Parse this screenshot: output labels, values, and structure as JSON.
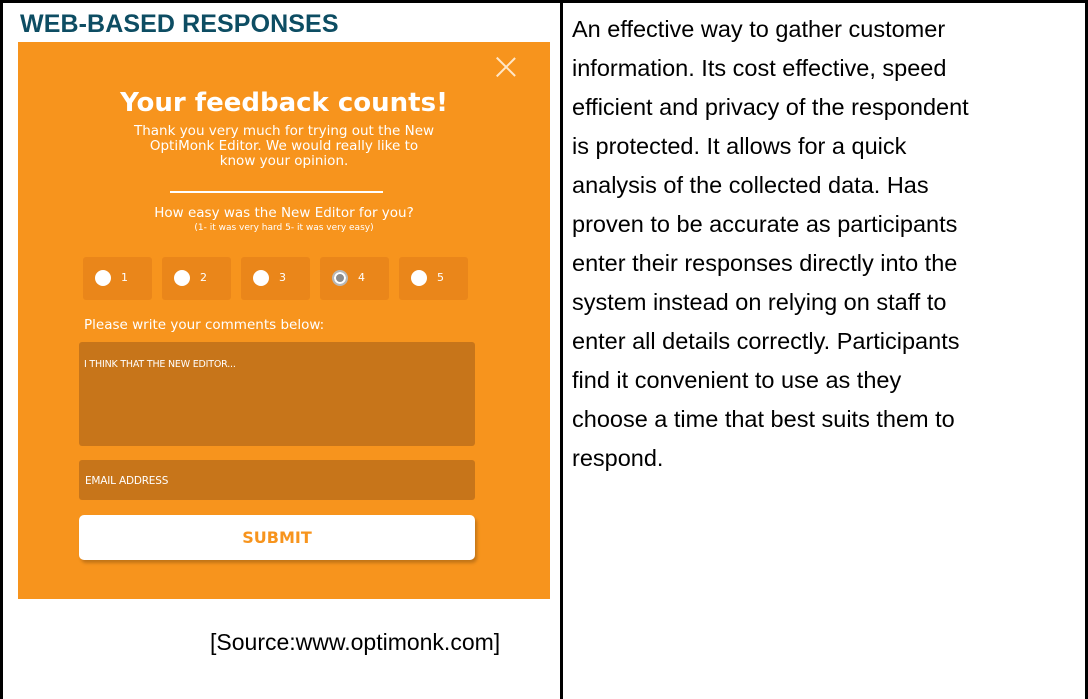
{
  "left_cell": {
    "heading": "WEB-BASED RESPONSES",
    "source": "[Source:www.optimonk.com]",
    "popup": {
      "close_icon": "close-icon",
      "title": "Your feedback counts!",
      "intro_lines": [
        "Thank you very much for trying out the New",
        "OptiMonk Editor. We would really like to",
        "know your opinion."
      ],
      "question": "How easy was the New Editor for you?",
      "scale_hint": "(1- it was very hard 5- it was very easy)",
      "ratings": [
        {
          "label": "1",
          "selected": false
        },
        {
          "label": "2",
          "selected": false
        },
        {
          "label": "3",
          "selected": false
        },
        {
          "label": "4",
          "selected": true
        },
        {
          "label": "5",
          "selected": false
        }
      ],
      "comments_label": "Please write your comments below:",
      "comments_value": "I THINK THAT THE NEW EDITOR...",
      "email_placeholder": "EMAIL ADDRESS",
      "submit_label": "SUBMIT",
      "colors": {
        "background": "#f7941d",
        "field": "#c7751a",
        "rating_box": "#ea861a",
        "text": "#ffffff"
      }
    }
  },
  "right_cell": {
    "lines": [
      "An effective way to gather customer",
      "information. Its cost effective, speed",
      "efficient and privacy of the respondent",
      "is protected. It allows for a quick",
      "analysis of the collected data. Has",
      "proven to be accurate as participants",
      "enter their responses directly into the",
      "system instead on relying on staff to",
      "enter all details correctly. Participants",
      "find it convenient to use as they",
      "choose a time that best suits them to",
      "respond."
    ]
  }
}
